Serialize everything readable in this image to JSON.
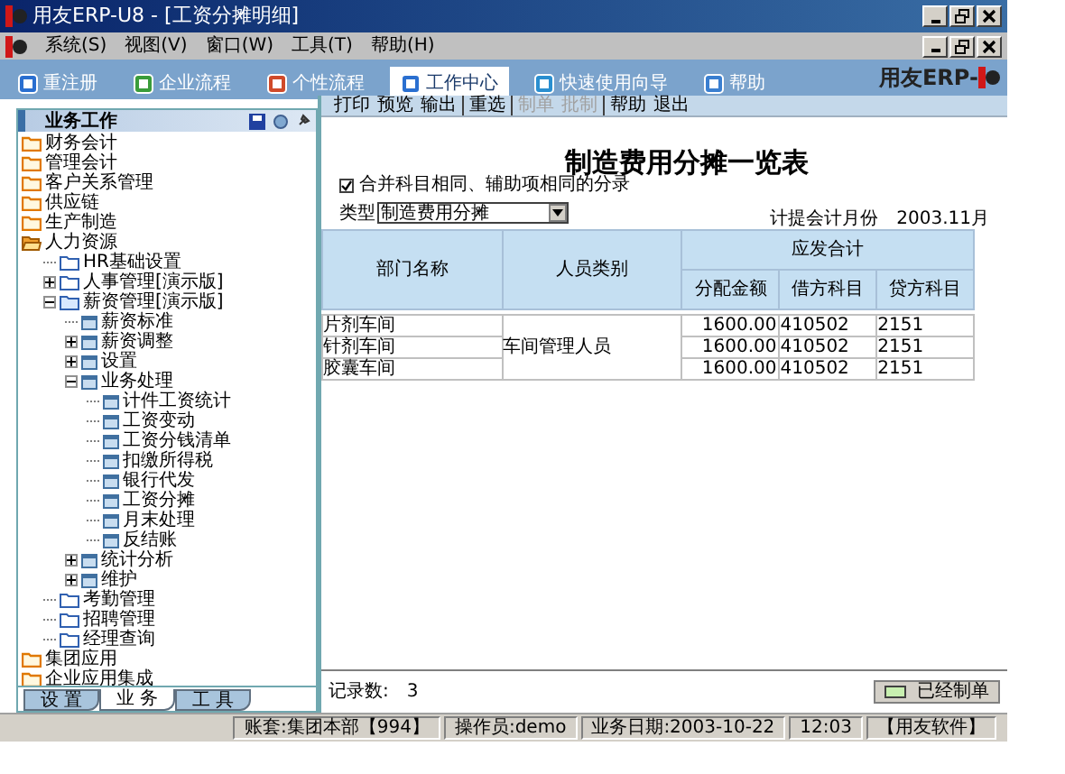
{
  "window": {
    "title": "用友ERP-U8 - [工资分摊明细]"
  },
  "menu": [
    "系统(S)",
    "视图(V)",
    "窗口(W)",
    "工具(T)",
    "帮助(H)"
  ],
  "nav": [
    {
      "label": "重注册",
      "selected": false
    },
    {
      "label": "企业流程",
      "selected": false
    },
    {
      "label": "个性流程",
      "selected": false
    },
    {
      "label": "工作中心",
      "selected": true
    },
    {
      "label": "快速使用向导",
      "selected": false
    },
    {
      "label": "帮助",
      "selected": false
    }
  ],
  "logo": "用友ERP-",
  "sidebar": {
    "title": "业务工作",
    "tree": [
      {
        "label": "财务会计",
        "kind": "folder",
        "expanded": false
      },
      {
        "label": "管理会计",
        "kind": "folder",
        "expanded": false
      },
      {
        "label": "客户关系管理",
        "kind": "folder",
        "expanded": false
      },
      {
        "label": "供应链",
        "kind": "folder",
        "expanded": false
      },
      {
        "label": "生产制造",
        "kind": "folder",
        "expanded": false
      },
      {
        "label": "人力资源",
        "kind": "folder",
        "expanded": true,
        "children": [
          {
            "label": "HR基础设置",
            "kind": "subfolder"
          },
          {
            "label": "人事管理[演示版]",
            "kind": "subfolder",
            "expanded": false
          },
          {
            "label": "薪资管理[演示版]",
            "kind": "subfolder",
            "expanded": true,
            "children": [
              {
                "label": "薪资标准",
                "kind": "item"
              },
              {
                "label": "薪资调整",
                "kind": "item",
                "expanded": false
              },
              {
                "label": "设置",
                "kind": "item",
                "expanded": false
              },
              {
                "label": "业务处理",
                "kind": "item",
                "expanded": true,
                "children": [
                  {
                    "label": "计件工资统计",
                    "kind": "item"
                  },
                  {
                    "label": "工资变动",
                    "kind": "item"
                  },
                  {
                    "label": "工资分钱清单",
                    "kind": "item"
                  },
                  {
                    "label": "扣缴所得税",
                    "kind": "item"
                  },
                  {
                    "label": "银行代发",
                    "kind": "item"
                  },
                  {
                    "label": "工资分摊",
                    "kind": "item"
                  },
                  {
                    "label": "月末处理",
                    "kind": "item"
                  },
                  {
                    "label": "反结账",
                    "kind": "item"
                  }
                ]
              },
              {
                "label": "统计分析",
                "kind": "item",
                "expanded": false
              },
              {
                "label": "维护",
                "kind": "item",
                "expanded": false
              }
            ]
          },
          {
            "label": "考勤管理",
            "kind": "subfolder"
          },
          {
            "label": "招聘管理",
            "kind": "subfolder"
          },
          {
            "label": "经理查询",
            "kind": "subfolder"
          }
        ]
      },
      {
        "label": "集团应用",
        "kind": "folder",
        "expanded": false
      },
      {
        "label": "企业应用集成",
        "kind": "folder",
        "expanded": false
      }
    ],
    "tabs": [
      {
        "label": "设 置",
        "selected": false
      },
      {
        "label": "业 务",
        "selected": true
      },
      {
        "label": "工 具",
        "selected": false
      }
    ]
  },
  "toolbar": [
    [
      {
        "label": "打印",
        "disabled": false
      },
      {
        "label": "预览",
        "disabled": false
      },
      {
        "label": "输出",
        "disabled": false
      }
    ],
    [
      {
        "label": "重选",
        "disabled": false
      }
    ],
    [
      {
        "label": "制单",
        "disabled": true
      },
      {
        "label": "批制",
        "disabled": true
      }
    ],
    [
      {
        "label": "帮助",
        "disabled": false
      },
      {
        "label": "退出",
        "disabled": false
      }
    ]
  ],
  "report": {
    "title": "制造费用分摊一览表",
    "merge_checkbox": {
      "label": "合并科目相同、辅助项相同的分录",
      "checked": true
    },
    "type_label": "类型",
    "type_value": "制造费用分摊",
    "period_label": "计提会计月份",
    "period_value": "2003.11月",
    "columns": {
      "dept": "部门名称",
      "category": "人员类别",
      "group": "应发合计",
      "amount": "分配金额",
      "debit": "借方科目",
      "credit": "贷方科目"
    },
    "category_merged": "车间管理人员",
    "rows": [
      {
        "dept": "片剂车间",
        "amount": "1600.00",
        "debit": "410502",
        "credit": "2151"
      },
      {
        "dept": "针剂车间",
        "amount": "1600.00",
        "debit": "410502",
        "credit": "2151"
      },
      {
        "dept": "胶囊车间",
        "amount": "1600.00",
        "debit": "410502",
        "credit": "2151"
      }
    ],
    "record_label": "记录数:",
    "record_count": "3",
    "status_button": "已经制单"
  },
  "status_bar": [
    "账套:集团本部【994】",
    "操作员:demo",
    "业务日期:2003-10-22",
    "12:03",
    "【用友软件】"
  ]
}
